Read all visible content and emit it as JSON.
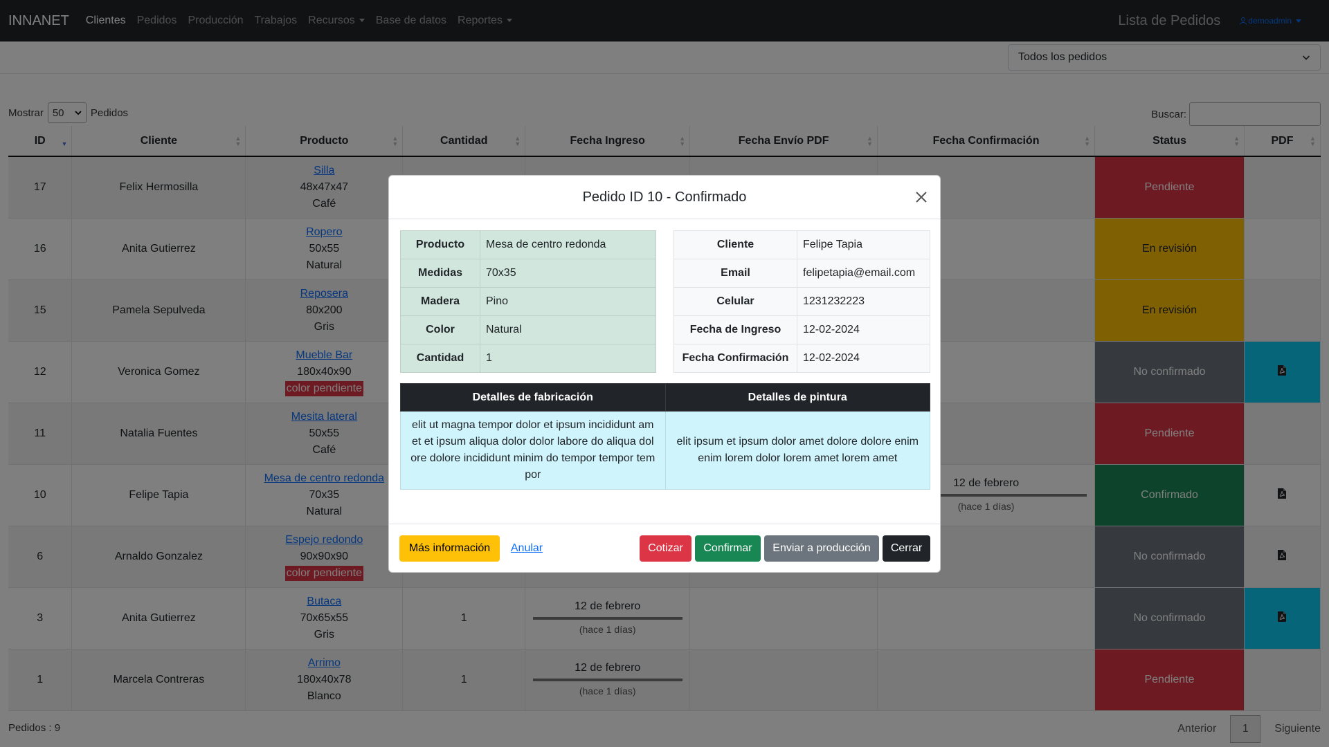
{
  "navbar": {
    "brand": "INNANET",
    "items": [
      {
        "label": "Clientes",
        "active": true,
        "dropdown": false
      },
      {
        "label": "Pedidos",
        "active": false,
        "dropdown": false
      },
      {
        "label": "Producción",
        "active": false,
        "dropdown": false
      },
      {
        "label": "Trabajos",
        "active": false,
        "dropdown": false
      },
      {
        "label": "Recursos",
        "active": false,
        "dropdown": true
      },
      {
        "label": "Base de datos",
        "active": false,
        "dropdown": false
      },
      {
        "label": "Reportes",
        "active": false,
        "dropdown": true
      }
    ],
    "page_title": "Lista de Pedidos",
    "user": "demoadmin"
  },
  "filter": {
    "selected": "Todos los pedidos"
  },
  "controls": {
    "show_label": "Mostrar",
    "page_length": "50",
    "entity_label": "Pedidos",
    "search_label": "Buscar:",
    "search_value": ""
  },
  "table": {
    "columns": [
      "ID",
      "Cliente",
      "Producto",
      "Cantidad",
      "Fecha Ingreso",
      "Fecha Envío PDF",
      "Fecha Confirmación",
      "Status",
      "PDF"
    ],
    "rows": [
      {
        "id": "17",
        "cliente": "Felix Hermosilla",
        "producto": "Silla",
        "medidas": "48x47x47",
        "color": "Café",
        "color_pendiente": false,
        "cantidad": "",
        "fecha_ingreso": "",
        "fecha_ingreso_rel": "",
        "fecha_confirmacion": "",
        "fecha_confirmacion_rel": "",
        "status": "Pendiente",
        "status_color": "#dc3545",
        "pdf": false,
        "pdf_color": ""
      },
      {
        "id": "16",
        "cliente": "Anita Gutierrez",
        "producto": "Ropero",
        "medidas": "50x55",
        "color": "Natural",
        "color_pendiente": false,
        "cantidad": "",
        "fecha_ingreso": "",
        "fecha_ingreso_rel": "",
        "fecha_confirmacion": "",
        "fecha_confirmacion_rel": "",
        "status": "En revisión",
        "status_color": "#ffc107",
        "pdf": false,
        "pdf_color": ""
      },
      {
        "id": "15",
        "cliente": "Pamela Sepulveda",
        "producto": "Reposera",
        "medidas": "80x200",
        "color": "Gris",
        "color_pendiente": false,
        "cantidad": "",
        "fecha_ingreso": "",
        "fecha_ingreso_rel": "",
        "fecha_confirmacion": "",
        "fecha_confirmacion_rel": "",
        "status": "En revisión",
        "status_color": "#ffc107",
        "pdf": false,
        "pdf_color": ""
      },
      {
        "id": "12",
        "cliente": "Veronica Gomez",
        "producto": "Mueble Bar",
        "medidas": "180x40x90",
        "color": "color pendiente",
        "color_pendiente": true,
        "cantidad": "",
        "fecha_ingreso": "",
        "fecha_ingreso_rel": "",
        "fecha_confirmacion": "",
        "fecha_confirmacion_rel": "",
        "status": "No confirmado",
        "status_color": "#6c757d",
        "pdf": true,
        "pdf_color": "#0dcaf0"
      },
      {
        "id": "11",
        "cliente": "Natalia Fuentes",
        "producto": "Mesita lateral",
        "medidas": "50x55",
        "color": "Café",
        "color_pendiente": false,
        "cantidad": "",
        "fecha_ingreso": "",
        "fecha_ingreso_rel": "",
        "fecha_confirmacion": "",
        "fecha_confirmacion_rel": "",
        "status": "Pendiente",
        "status_color": "#dc3545",
        "pdf": false,
        "pdf_color": ""
      },
      {
        "id": "10",
        "cliente": "Felipe Tapia",
        "producto": "Mesa de centro redonda",
        "medidas": "70x35",
        "color": "Natural",
        "color_pendiente": false,
        "cantidad": "",
        "fecha_ingreso": "",
        "fecha_ingreso_rel": "",
        "fecha_confirmacion": "12 de febrero",
        "fecha_confirmacion_rel": "(hace 1 días)",
        "status": "Confirmado",
        "status_color": "#198754",
        "pdf": true,
        "pdf_color": ""
      },
      {
        "id": "6",
        "cliente": "Arnaldo Gonzalez",
        "producto": "Espejo redondo",
        "medidas": "90x90x90",
        "color": "color pendiente",
        "color_pendiente": true,
        "cantidad": "",
        "fecha_ingreso": "",
        "fecha_ingreso_rel": "",
        "fecha_confirmacion": "",
        "fecha_confirmacion_rel": "",
        "status": "No confirmado",
        "status_color": "#6c757d",
        "pdf": true,
        "pdf_color": ""
      },
      {
        "id": "3",
        "cliente": "Anita Gutierrez",
        "producto": "Butaca",
        "medidas": "70x65x55",
        "color": "Gris",
        "color_pendiente": false,
        "cantidad": "1",
        "fecha_ingreso": "12 de febrero",
        "fecha_ingreso_rel": "(hace 1 días)",
        "fecha_confirmacion": "",
        "fecha_confirmacion_rel": "",
        "status": "No confirmado",
        "status_color": "#6c757d",
        "pdf": true,
        "pdf_color": "#0dcaf0"
      },
      {
        "id": "1",
        "cliente": "Marcela Contreras",
        "producto": "Arrimo",
        "medidas": "180x40x78",
        "color": "Blanco",
        "color_pendiente": false,
        "cantidad": "1",
        "fecha_ingreso": "12 de febrero",
        "fecha_ingreso_rel": "(hace 1 días)",
        "fecha_confirmacion": "",
        "fecha_confirmacion_rel": "",
        "status": "Pendiente",
        "status_color": "#dc3545",
        "pdf": false,
        "pdf_color": ""
      }
    ]
  },
  "footer": {
    "count_label": "Pedidos : 9",
    "prev": "Anterior",
    "page": "1",
    "next": "Siguiente"
  },
  "modal": {
    "title": "Pedido ID 10 - Confirmado",
    "product_info": [
      {
        "key": "Producto",
        "value": "Mesa de centro redonda"
      },
      {
        "key": "Medidas",
        "value": "70x35"
      },
      {
        "key": "Madera",
        "value": "Pino"
      },
      {
        "key": "Color",
        "value": "Natural"
      },
      {
        "key": "Cantidad",
        "value": "1"
      }
    ],
    "client_info": [
      {
        "key": "Cliente",
        "value": "Felipe Tapia"
      },
      {
        "key": "Email",
        "value": "felipetapia@email.com"
      },
      {
        "key": "Celular",
        "value": "1231232223"
      },
      {
        "key": "Fecha de Ingreso",
        "value": "12-02-2024"
      },
      {
        "key": "Fecha Confirmación",
        "value": "12-02-2024"
      }
    ],
    "details_headers": [
      "Detalles de fabricación",
      "Detalles de pintura"
    ],
    "fabricacion": "elit ut magna tempor dolor et ipsum incididunt am et et ipsum aliqua dolor dolor labore do aliqua dol ore dolore incididunt minim do tempor tempor tem por",
    "pintura": "elit ipsum et ipsum dolor amet dolore dolore enim enim lorem dolor lorem amet lorem amet",
    "buttons": {
      "more_info": "Más información",
      "anular": "Anular",
      "cotizar": "Cotizar",
      "confirmar": "Confirmar",
      "enviar": "Enviar a producción",
      "cerrar": "Cerrar"
    }
  }
}
